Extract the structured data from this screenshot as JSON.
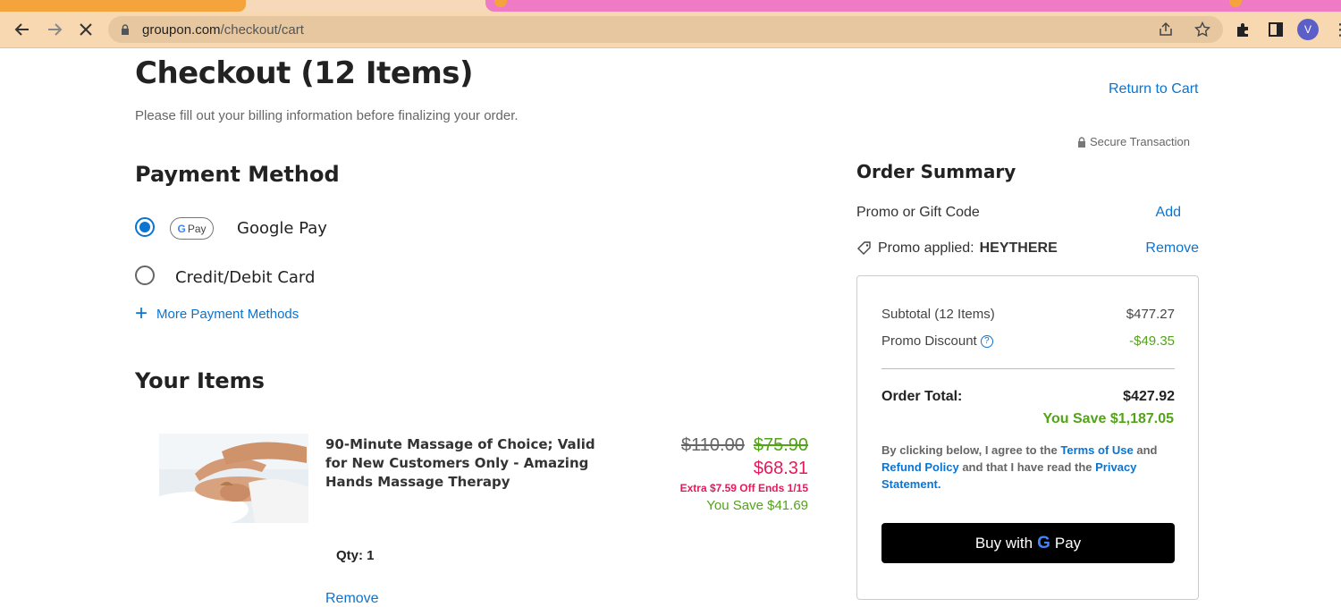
{
  "browser": {
    "url_host": "groupon.com",
    "url_path": "/checkout/cart",
    "avatar_letter": "V"
  },
  "header": {
    "title": "Checkout (12 Items)",
    "subtitle": "Please fill out your billing information before finalizing your order.",
    "return_link": "Return to Cart",
    "secure_label": "Secure Transaction"
  },
  "payment": {
    "heading": "Payment Method",
    "options": [
      {
        "label": "Google Pay",
        "badge": "Pay",
        "selected": true
      },
      {
        "label": "Credit/Debit Card",
        "selected": false
      }
    ],
    "more_label": "More Payment Methods"
  },
  "items": {
    "heading": "Your Items",
    "list": [
      {
        "name": "90-Minute Massage of Choice; Valid for New Customers Only - Amazing Hands Massage Therapy",
        "original_price": "$110.00",
        "was_price": "$75.90",
        "final_price": "$68.31",
        "extra_off": "Extra $7.59 Off Ends 1/15",
        "you_save": "You Save $41.69",
        "qty": "Qty: 1",
        "remove_label": "Remove"
      }
    ]
  },
  "summary": {
    "title": "Order Summary",
    "promo_label": "Promo or Gift Code",
    "promo_add": "Add",
    "promo_applied_prefix": "Promo applied:",
    "promo_code": "HEYTHERE",
    "promo_remove": "Remove",
    "subtotal_label": "Subtotal (12 Items)",
    "subtotal_value": "$477.27",
    "discount_label": "Promo Discount",
    "discount_value": "-$49.35",
    "total_label": "Order Total:",
    "total_value": "$427.92",
    "you_save": "You Save $1,187.05",
    "legal_1": "By clicking below, I agree to the",
    "terms": "Terms of Use",
    "legal_2": "and",
    "refund": "Refund Policy",
    "legal_3": "and that I have read the",
    "privacy": "Privacy Statement.",
    "buy_prefix": "Buy with",
    "buy_g": "G",
    "buy_pay": "Pay"
  },
  "colors": {
    "link": "#0b74d1",
    "green": "#53a318",
    "red": "#e31b5a"
  }
}
